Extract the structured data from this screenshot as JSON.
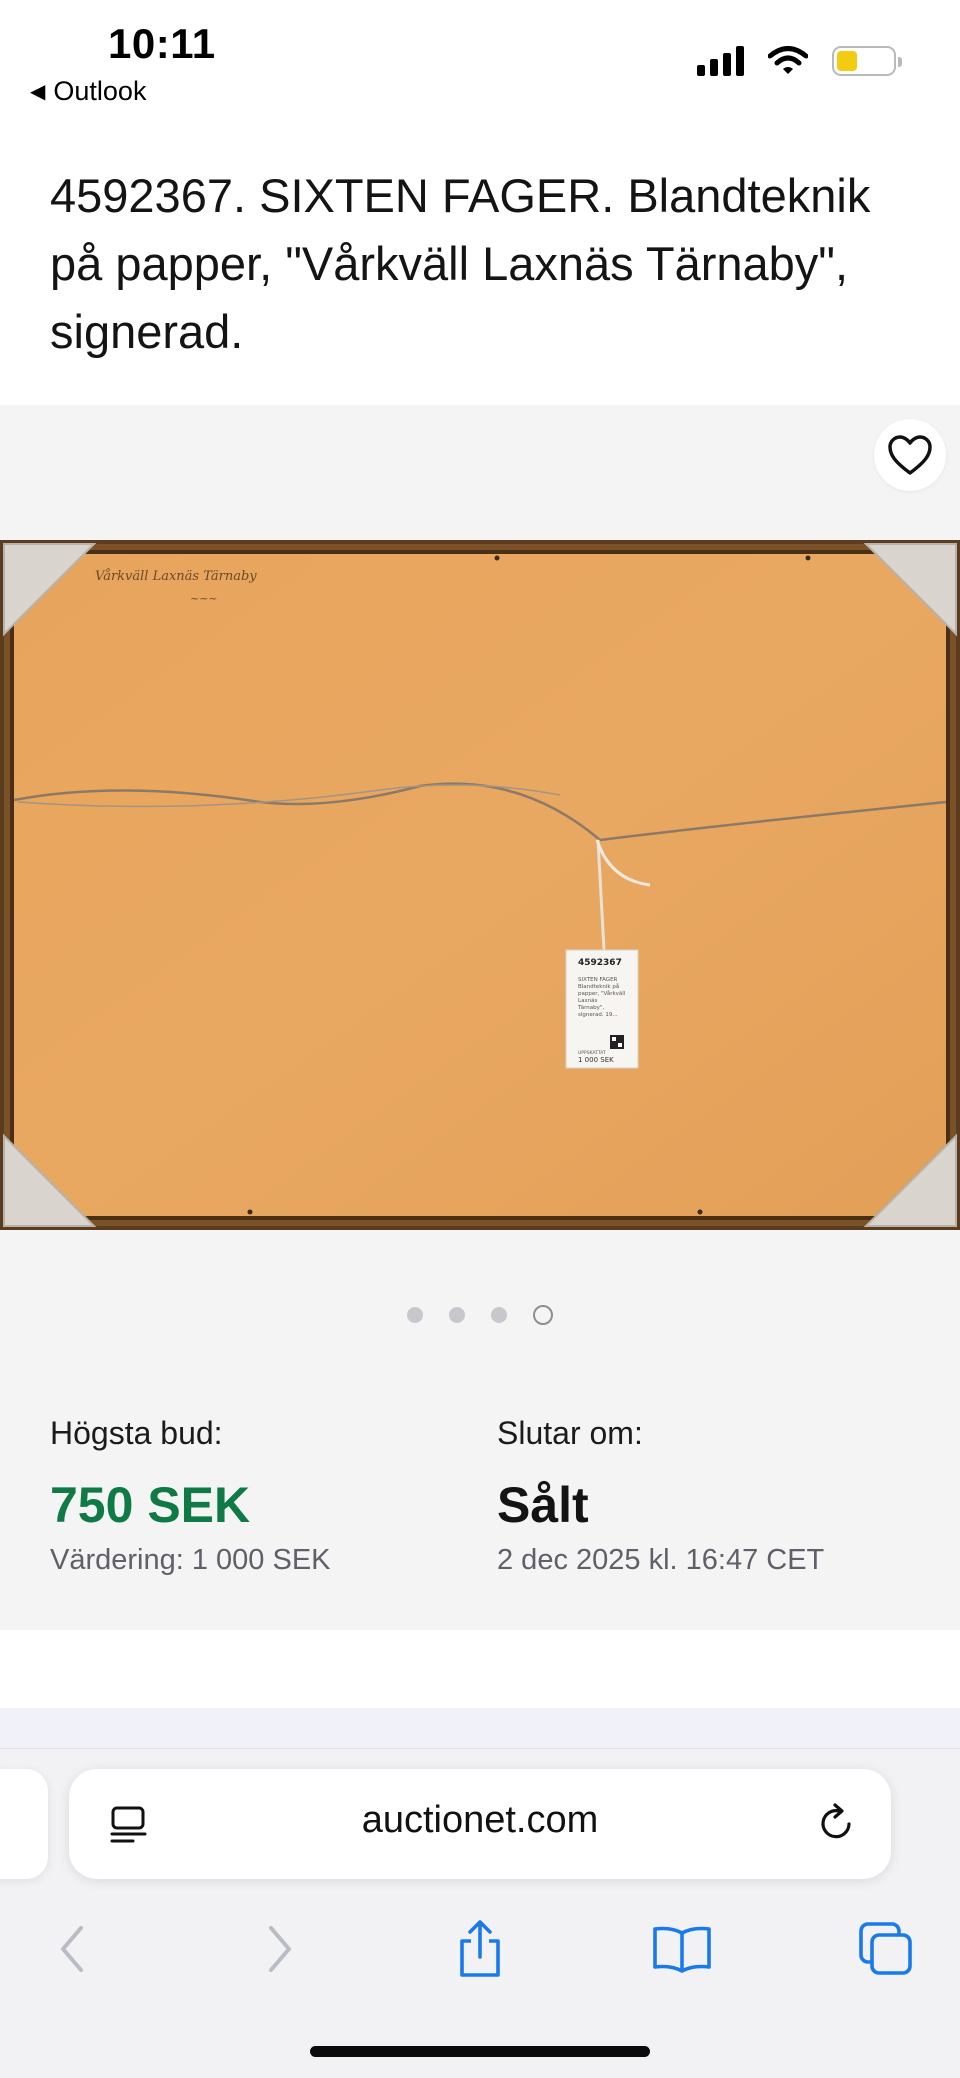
{
  "status_bar": {
    "time": "10:11",
    "back_app": "Outlook",
    "battery_color": "#f4cb13"
  },
  "lot": {
    "title": "4592367. SIXTEN FAGER. Blandteknik på papper, \"Vårkväll Laxnäs Tärnaby\", signerad."
  },
  "gallery": {
    "image_count": 4,
    "active_index": 3,
    "favorite_icon": "heart-outline-icon",
    "label_card": {
      "lot_number": "4592367",
      "lines": [
        "SIXTEN FAGER",
        "Blandteknik på",
        "papper, \"Vårkväll",
        "Laxnäs",
        "Tärnaby\",",
        "signerad. 19..."
      ],
      "estimate_label": "UPPSKATTAT",
      "estimate_value": "1 000 SEK"
    },
    "inscription": "Vårkväll  Laxnäs Tärnaby"
  },
  "bid": {
    "highest_bid_label": "Högsta bud:",
    "highest_bid_value": "750 SEK",
    "valuation_text": "Värdering: 1 000 SEK",
    "ends_label": "Slutar om:",
    "ends_value": "Sålt",
    "ends_date": "2 dec 2025 kl. 16:47 CET",
    "accent_color": "#0f7a46"
  },
  "browser": {
    "url": "auctionet.com",
    "reader_icon": "reader-mode-icon",
    "reload_icon": "reload-icon",
    "toolbar": [
      "back-icon",
      "forward-icon",
      "share-icon",
      "bookmarks-icon",
      "tabs-icon"
    ],
    "accent_color": "#1a7aea"
  }
}
